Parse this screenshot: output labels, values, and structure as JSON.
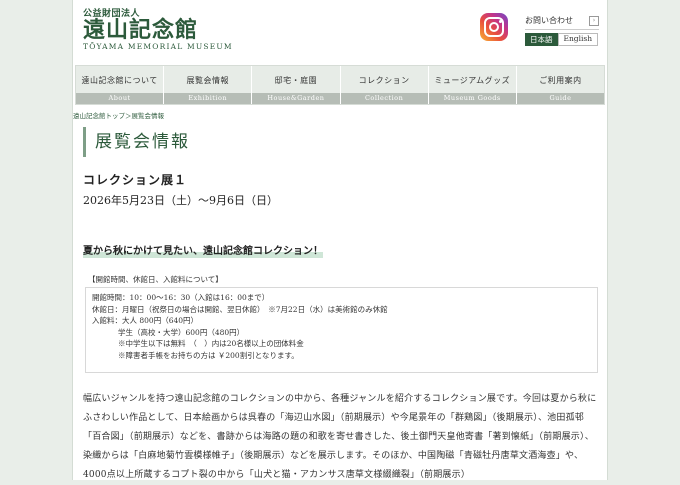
{
  "header": {
    "logo_sub": "公益財団法人",
    "logo_main": "遠山記念館",
    "logo_en": "TŌYAMA MEMORIAL MUSEUM",
    "contact_label": "お問い合わせ",
    "contact_chevron": "›",
    "lang_ja": "日本語",
    "lang_en": "English"
  },
  "nav": [
    {
      "jp": "遠山記念館について",
      "en": "About"
    },
    {
      "jp": "展覧会情報",
      "en": "Exhibition"
    },
    {
      "jp": "邸宅・庭園",
      "en": "House&Garden"
    },
    {
      "jp": "コレクション",
      "en": "Collection"
    },
    {
      "jp": "ミュージアムグッズ",
      "en": "Museum Goods"
    },
    {
      "jp": "ご利用案内",
      "en": "Guide"
    }
  ],
  "breadcrumb": "遠山記念館トップ＞展覧会情報",
  "section_title": "展覧会情報",
  "exhibit": {
    "title": "コレクション展１",
    "date": "2026年5月23日（土）〜9月6日（日）",
    "catch": "夏から秋にかけて見たい、遠山記念館コレクション！"
  },
  "info": {
    "heading": "【開館時間、休館日、入館料について】",
    "lines": [
      "開館時間：10：00〜16：30（入館は16：00まで）",
      "休館日：月曜日（祝祭日の場合は開館、翌日休館）　※7月22日（水）は美術館のみ休館",
      "入館料：大人 800円（640円）",
      "学生（高校・大学）600円（480円）",
      "※中学生以下は無料　（　）内は20名様以上の団体料金",
      "※障害者手帳をお持ちの方は ￥200割引となります。"
    ]
  },
  "body": "幅広いジャンルを持つ遠山記念館のコレクションの中から、各種ジャンルを紹介するコレクション展です。今回は夏から秋にふさわしい作品として、日本絵画からは呉春の「海辺山水図」（前期展示）や今尾景年の「群鶏図」（後期展示）、池田孤邨「百合図」（前期展示）などを、書跡からは海路の題の和歌を寄せ書きした、後土御門天皇他寄書「著到懐紙」（前期展示）、染織からは「白麻地菊竹雲模様帷子」（後期展示）などを展示します。そのほか、中国陶磁「青磁牡丹唐草文酒海壺」や、4000点以上所蔵するコプト裂の中から「山犬と猫・アカンサス唐草文様綴織裂」（前期展示）"
}
